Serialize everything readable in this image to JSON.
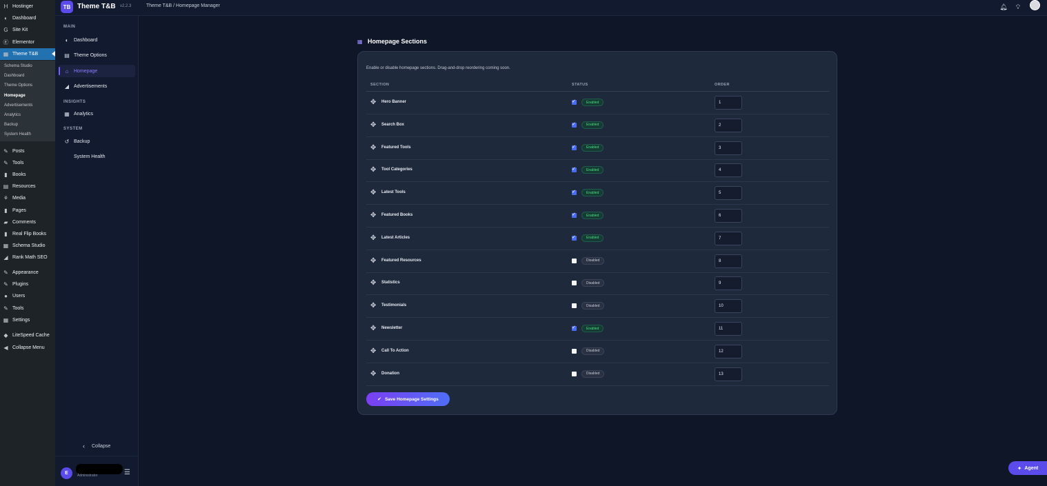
{
  "wp_sidebar": {
    "items": [
      {
        "label": "Hostinger",
        "icon": "hostinger-icon",
        "glyph": "H"
      },
      {
        "label": "Dashboard",
        "icon": "dashboard-icon",
        "glyph": "◐"
      },
      {
        "label": "Site Kit",
        "icon": "google-icon",
        "glyph": "G"
      },
      {
        "label": "Elementor",
        "icon": "elementor-icon",
        "glyph": "Ⓔ"
      },
      {
        "label": "Theme T&B",
        "icon": "grid-icon",
        "glyph": "▦"
      }
    ],
    "submenu": [
      "Schema Studio",
      "Dashboard",
      "Theme Options",
      "Homepage",
      "Advertisements",
      "Analytics",
      "Backup",
      "System Health"
    ],
    "items2": [
      {
        "label": "Posts",
        "icon": "pin-icon",
        "glyph": "✎"
      },
      {
        "label": "Tools",
        "icon": "tools-icon",
        "glyph": "✎"
      },
      {
        "label": "Books",
        "icon": "book-icon",
        "glyph": "▮"
      },
      {
        "label": "Resources",
        "icon": "resources-icon",
        "glyph": "▤"
      },
      {
        "label": "Media",
        "icon": "media-icon",
        "glyph": "⚘"
      },
      {
        "label": "Pages",
        "icon": "pages-icon",
        "glyph": "▮"
      },
      {
        "label": "Comments",
        "icon": "comments-icon",
        "glyph": "▰"
      },
      {
        "label": "Real Flip Books",
        "icon": "flipbook-icon",
        "glyph": "▮"
      },
      {
        "label": "Schema Studio",
        "icon": "schema-icon",
        "glyph": "▦"
      },
      {
        "label": "Rank Math SEO",
        "icon": "rankmath-icon",
        "glyph": "◢"
      }
    ],
    "items3": [
      {
        "label": "Appearance",
        "icon": "appearance-icon",
        "glyph": "✎"
      },
      {
        "label": "Plugins",
        "icon": "plugins-icon",
        "glyph": "✎"
      },
      {
        "label": "Users",
        "icon": "users-icon",
        "glyph": "●"
      },
      {
        "label": "Tools",
        "icon": "tools-icon",
        "glyph": "✎"
      },
      {
        "label": "Settings",
        "icon": "settings-icon",
        "glyph": "▦"
      }
    ],
    "items4": [
      {
        "label": "LiteSpeed Cache",
        "icon": "litespeed-icon",
        "glyph": "◆"
      },
      {
        "label": "Collapse Menu",
        "icon": "collapse-icon",
        "glyph": "◀"
      }
    ]
  },
  "topbar": {
    "logo": "TB",
    "title": "Theme T&B",
    "version": "v2.2.3",
    "breadcrumb": "Theme T&B  /  Homepage Manager"
  },
  "plugin_nav": {
    "headings": [
      "MAIN",
      "INSIGHTS",
      "SYSTEM"
    ],
    "main": [
      {
        "label": "Dashboard",
        "glyph": "◐"
      },
      {
        "label": "Theme Options",
        "glyph": "▤"
      },
      {
        "label": "Homepage",
        "glyph": "⌂"
      },
      {
        "label": "Advertisements",
        "glyph": "◢"
      }
    ],
    "insights": [
      {
        "label": "Analytics",
        "glyph": "▦"
      }
    ],
    "system": [
      {
        "label": "Backup",
        "glyph": "↺"
      },
      {
        "label": "System Health",
        "glyph": ""
      }
    ],
    "collapse": "Collapse",
    "user_initial": "E",
    "user_role": "Administrator"
  },
  "main": {
    "title": "Homepage Sections",
    "description": "Enable or disable homepage sections. Drag-and-drop reordering coming soon.",
    "columns": [
      "SECTION",
      "STATUS",
      "ORDER"
    ],
    "rows": [
      {
        "name": "Hero Banner",
        "enabled": true,
        "status": "Enabled",
        "order": "1"
      },
      {
        "name": "Search Box",
        "enabled": true,
        "status": "Enabled",
        "order": "2"
      },
      {
        "name": "Featured Tools",
        "enabled": true,
        "status": "Enabled",
        "order": "3"
      },
      {
        "name": "Tool Categories",
        "enabled": true,
        "status": "Enabled",
        "order": "4"
      },
      {
        "name": "Latest Tools",
        "enabled": true,
        "status": "Enabled",
        "order": "5"
      },
      {
        "name": "Featured Books",
        "enabled": true,
        "status": "Enabled",
        "order": "6"
      },
      {
        "name": "Latest Articles",
        "enabled": true,
        "status": "Enabled",
        "order": "7"
      },
      {
        "name": "Featured Resources",
        "enabled": false,
        "status": "Disabled",
        "order": "8"
      },
      {
        "name": "Statistics",
        "enabled": false,
        "status": "Disabled",
        "order": "9"
      },
      {
        "name": "Testimonials",
        "enabled": false,
        "status": "Disabled",
        "order": "10"
      },
      {
        "name": "Newsletter",
        "enabled": true,
        "status": "Enabled",
        "order": "11"
      },
      {
        "name": "Call To Action",
        "enabled": false,
        "status": "Disabled",
        "order": "12"
      },
      {
        "name": "Donation",
        "enabled": false,
        "status": "Disabled",
        "order": "13"
      }
    ],
    "save_label": "Save Homepage Settings"
  },
  "agent_label": "Agent",
  "colors": {
    "accent": "#5b4bea",
    "enabled": "#4ade80",
    "wp_active": "#2271b1"
  }
}
